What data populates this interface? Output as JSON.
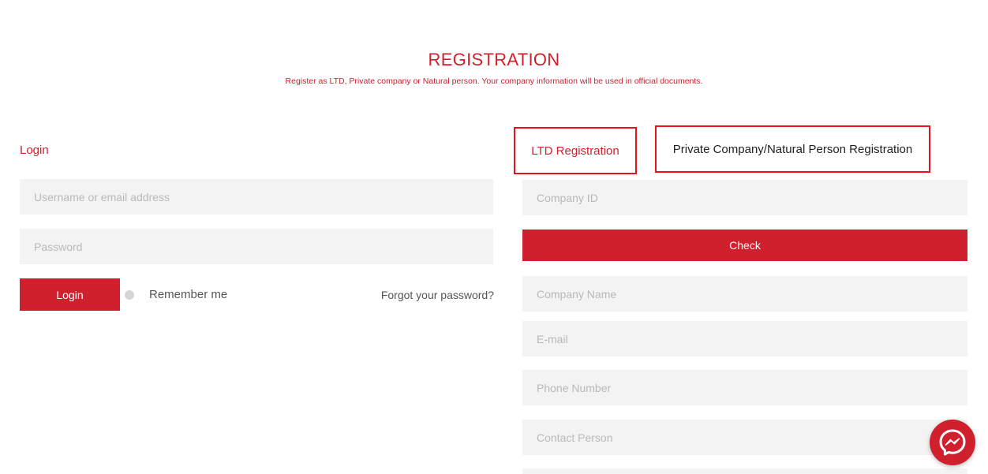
{
  "header": {
    "title": "REGISTRATION",
    "subtitle": "Register as LTD, Private company or Natural person. Your company information will be used in official documents."
  },
  "login": {
    "heading": "Login",
    "username_placeholder": "Username or email address",
    "password_placeholder": "Password",
    "login_button": "Login",
    "remember_label": "Remember me",
    "forgot_link": "Forgot your password?"
  },
  "registration": {
    "tabs": [
      {
        "label": "LTD Registration",
        "active": true
      },
      {
        "label": "Private Company/Natural Person Registration",
        "active": false
      }
    ],
    "company_id_placeholder": "Company ID",
    "check_button": "Check",
    "company_name_placeholder": "Company Name",
    "email_placeholder": "E-mail",
    "phone_placeholder": "Phone Number",
    "contact_person_placeholder": "Contact Person"
  },
  "icons": {
    "chat": "messenger-icon"
  },
  "colors": {
    "accent": "#d0202e",
    "highlight_border": "#e4141d",
    "field_bg": "#f3f3f3"
  }
}
